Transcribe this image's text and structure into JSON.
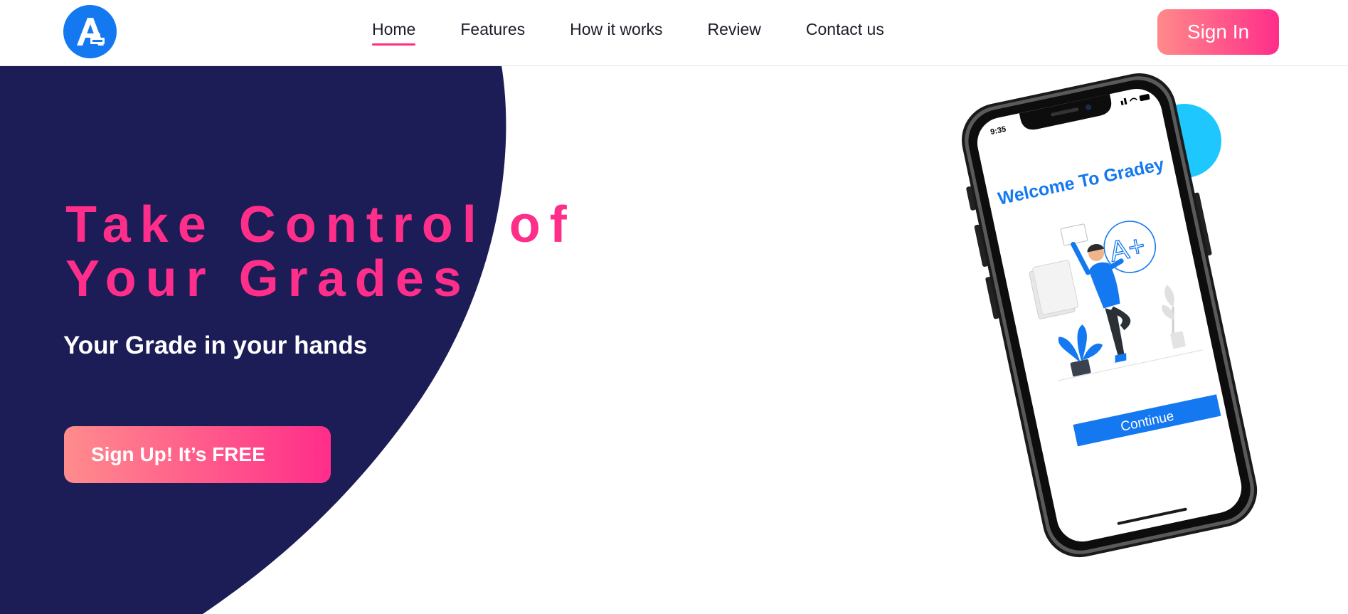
{
  "header": {
    "logo_text": "A",
    "nav": [
      {
        "label": "Home",
        "active": true
      },
      {
        "label": "Features",
        "active": false
      },
      {
        "label": "How it works",
        "active": false
      },
      {
        "label": "Review",
        "active": false
      },
      {
        "label": "Contact us",
        "active": false
      }
    ],
    "sign_in_label": "Sign In"
  },
  "hero": {
    "title_line1": "Take Control of",
    "title_line2": "Your Grades",
    "subtitle": "Your Grade in your hands",
    "cta_label": "Sign Up! It’s FREE"
  },
  "phone": {
    "time": "9:35",
    "welcome": "Welcome To Gradey",
    "grade": "A+",
    "continue_label": "Continue"
  },
  "colors": {
    "navy": "#1c1c56",
    "pink": "#ff2e8a",
    "brand_blue": "#1478f0",
    "accent_cyan": "#1ec8ff"
  }
}
